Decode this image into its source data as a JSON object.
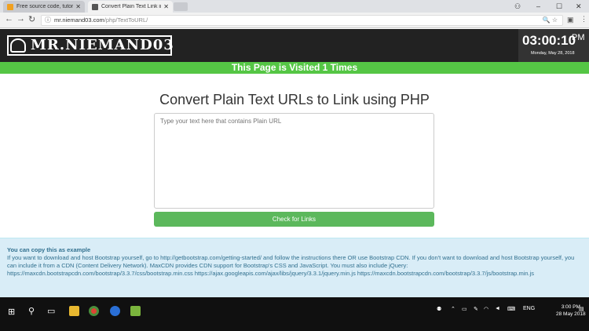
{
  "browser": {
    "tabs": [
      {
        "label": "Free source code, tutorial",
        "favicon_color": "#f0a020"
      },
      {
        "label": "Convert Plain Text Link in",
        "favicon_color": "#555555"
      }
    ],
    "url_domain": "mr.niemand03.com",
    "url_path": "/php/TextToURL/",
    "window_controls": {
      "minimize": "–",
      "maximize": "☐",
      "close": "✕",
      "profile": "⚇"
    }
  },
  "site": {
    "logo_text": "MR.NIEMAND03",
    "clock_time": "03:00:10",
    "clock_ampm": "PM",
    "clock_date": "Monday, May 28, 2018",
    "visited_banner": "This Page is Visited 1 Times"
  },
  "main": {
    "title": "Convert Plain Text URLs to Link using PHP",
    "textarea_placeholder": "Type your text here that contains Plain URL",
    "check_button": "Check for Links"
  },
  "alert": {
    "heading": "You can copy this as example",
    "body": "If you want to download and host Bootstrap yourself, go to http://getbootstrap.com/getting-started/ and follow the instructions there OR use Bootstrap CDN. If you don't want to download and host Bootstrap yourself, you can include it from a CDN (Content Delivery Network). MaxCDN provides CDN support for Bootstrap's CSS and JavaScript. You must also include jQuery: https://maxcdn.bootstrapcdn.com/bootstrap/3.3.7/css/bootstrap.min.css https://ajax.googleapis.com/ajax/libs/jquery/3.3.1/jquery.min.js https://maxcdn.bootstrapcdn.com/bootstrap/3.3.7/js/bootstrap.min.js"
  },
  "taskbar": {
    "language": "ENG",
    "time": "3:00 PM",
    "date": "28 May 2018"
  }
}
